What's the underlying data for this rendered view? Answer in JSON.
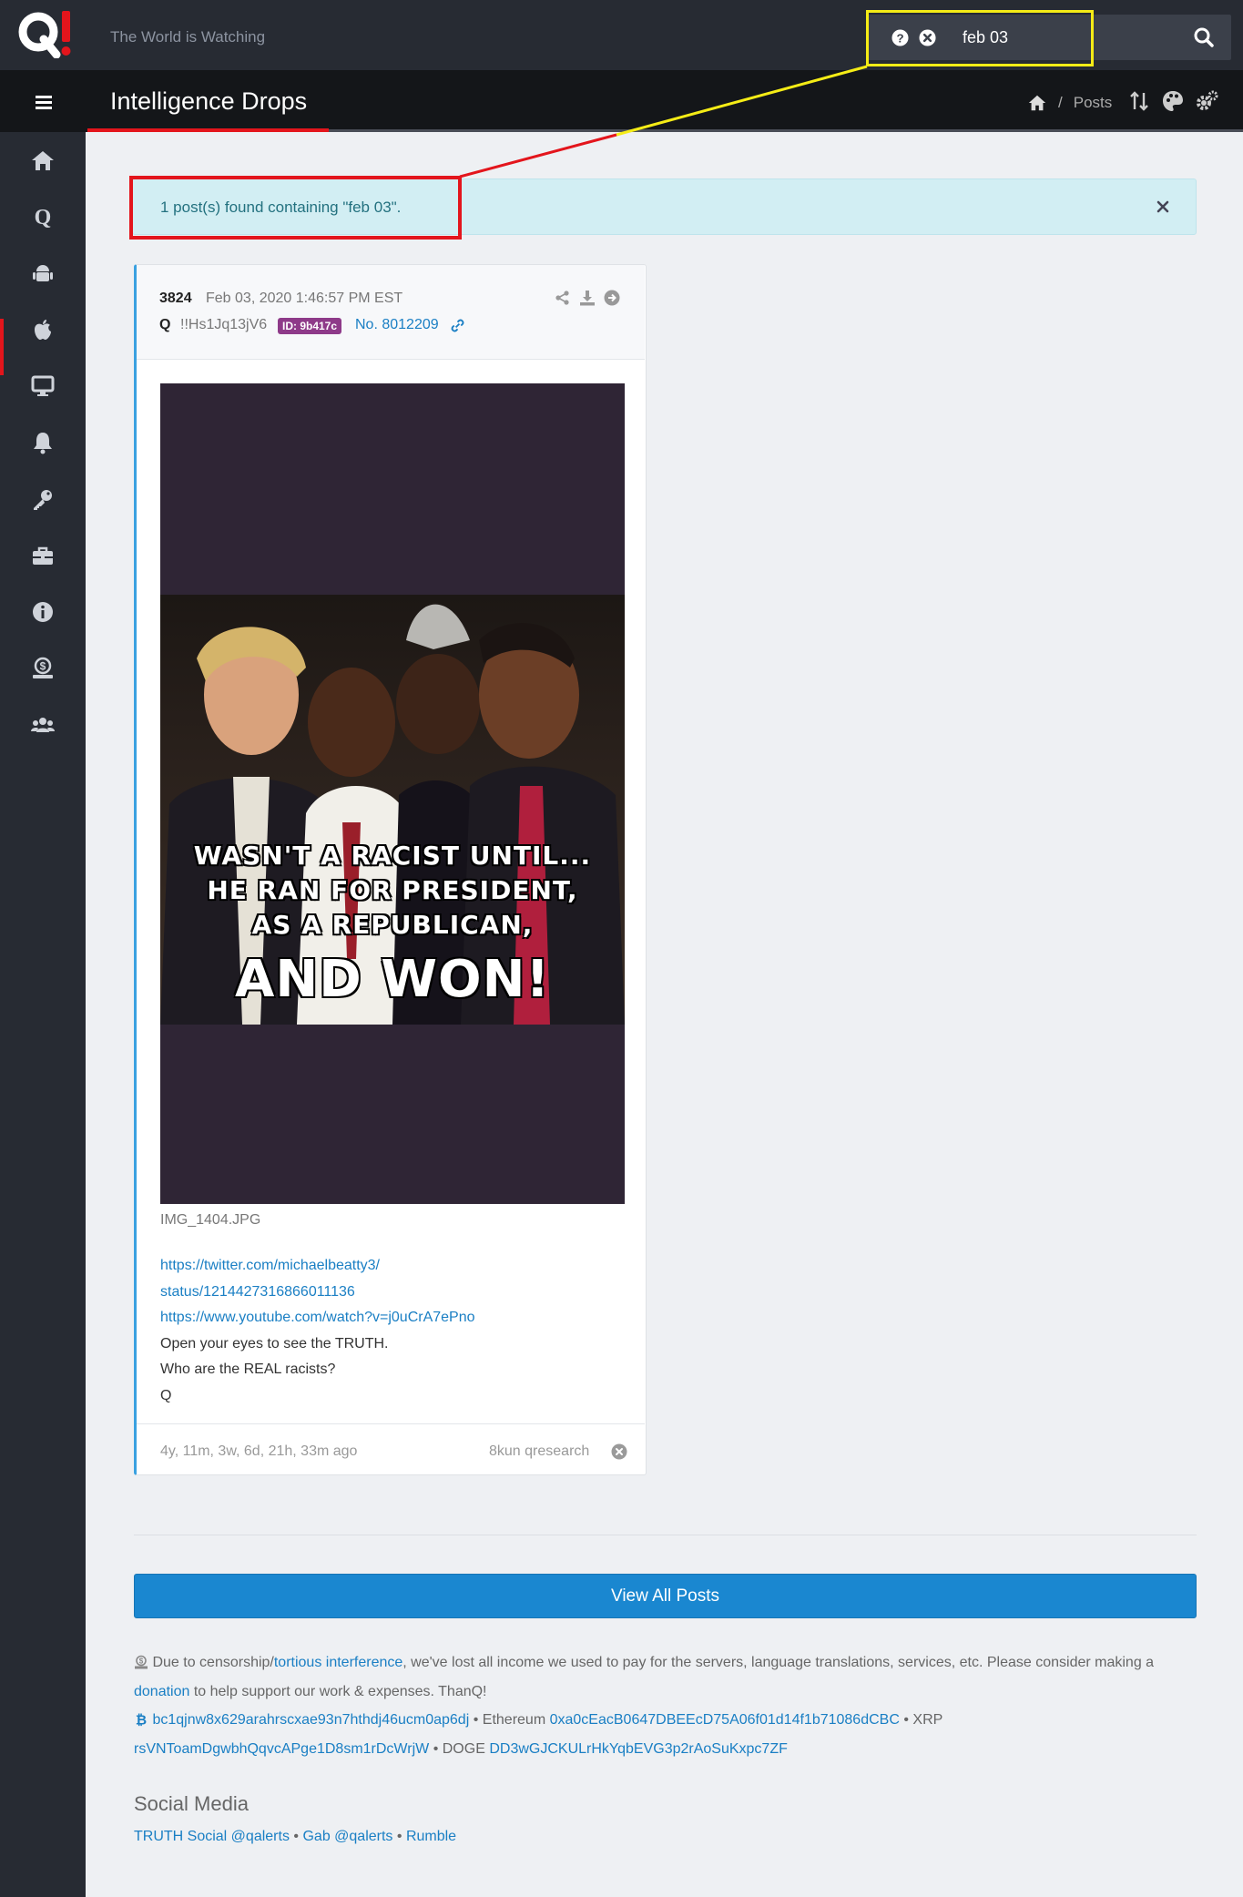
{
  "header": {
    "tagline": "The World is Watching",
    "search_value": "feb 03"
  },
  "subheader": {
    "title": "Intelligence Drops",
    "breadcrumb_current": "Posts",
    "breadcrumb_separator": "/"
  },
  "sidebar": {
    "items": [
      "home-icon",
      "q-icon",
      "android-icon",
      "apple-icon",
      "desktop-icon",
      "bell-icon",
      "key-icon",
      "toolbox-icon",
      "info-icon",
      "donate-icon",
      "users-icon"
    ],
    "active_index": 1
  },
  "alert": {
    "text": "1 post(s) found containing \"feb 03\"."
  },
  "post": {
    "number": "3824",
    "date": "Feb 03, 2020 1:46:57 PM EST",
    "author": "Q",
    "tripcode": "!!Hs1Jq13jV6",
    "id_badge": "ID: 9b417c",
    "post_link": "No. 8012209",
    "image_caption": {
      "line1": "WASN'T A RACIST UNTIL...",
      "line2": "HE RAN FOR PRESIDENT,",
      "line3": "AS A REPUBLICAN,",
      "line4": "AND WON!"
    },
    "filename": "IMG_1404.JPG",
    "link1_a": "https://twitter.com/michaelbeatty3/",
    "link1_b": "status/1214427316866011136",
    "link2": "https://www.youtube.com/watch?v=j0uCrA7ePno",
    "line1": "Open your eyes to see the TRUTH.",
    "line2": "Who are the REAL racists?",
    "line3": "Q",
    "age": "4y, 11m, 3w, 6d, 21h, 33m ago",
    "source": "8kun qresearch"
  },
  "view_all_label": "View All Posts",
  "notice": {
    "part1": "Due to censorship/",
    "link1": "tortious interference",
    "part2": ", we've lost all income we used to pay for the servers, language translations, services, etc. Please consider making a ",
    "link2": "donation",
    "part3": " to help support our work & expenses. ThanQ!",
    "btc": "bc1qjnw8x629arahrscxae93n7hthdj46ucm0ap6dj",
    "eth_label": "Ethereum",
    "eth": "0xa0cEacB0647DBEEcD75A06f01d14f1b71086dCBC",
    "xrp_label": "XRP",
    "xrp": "rsVNToamDgwbhQqvcAPge1D8sm1rDcWrjW",
    "doge_label": "DOGE",
    "doge": "DD3wGJCKULrHkYqbEVG3p2rAoSuKxpc7ZF",
    "sep": "•"
  },
  "social": {
    "heading": "Social Media",
    "truth": "TRUTH Social @qalerts",
    "gab": "Gab @qalerts",
    "rumble": "Rumble",
    "sep": "•"
  },
  "colors": {
    "accent_red": "#e3151c",
    "highlight_yellow": "#f5ec16",
    "link_blue": "#1a7fc4",
    "button_blue": "#1a87d0",
    "alert_bg": "#d2eef3",
    "id_badge": "#8e3a89"
  }
}
